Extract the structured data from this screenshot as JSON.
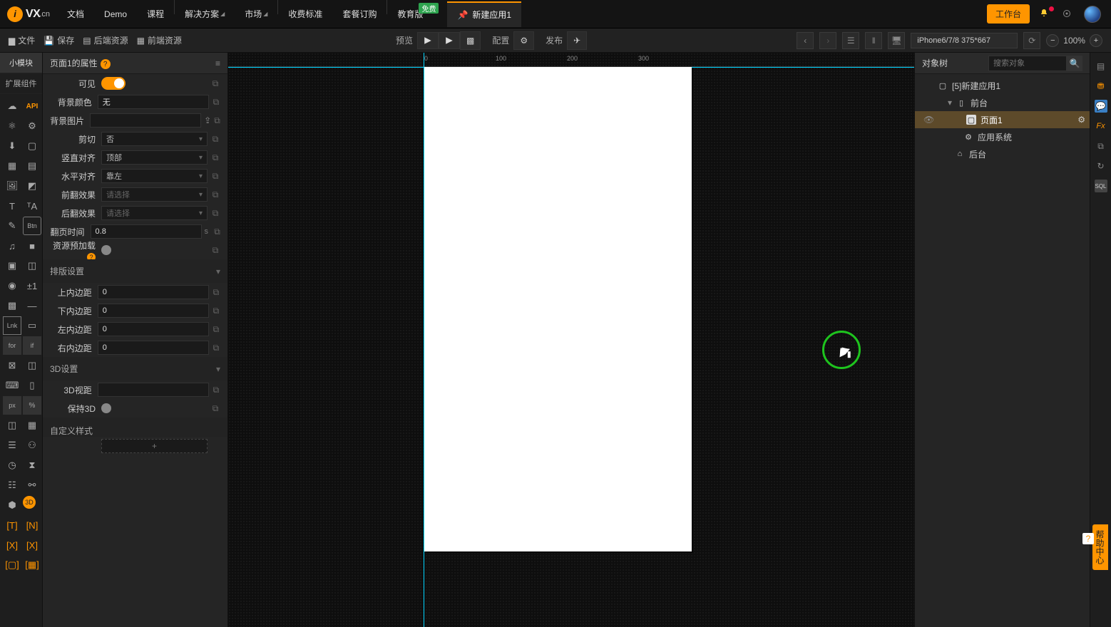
{
  "brand": {
    "short": "i",
    "name": "VX",
    "suffix": ".cn"
  },
  "nav": {
    "items": [
      "文档",
      "Demo",
      "课程",
      "解决方案",
      "市场",
      "收费标准",
      "套餐订购",
      "教育版"
    ],
    "free_badge": "免费"
  },
  "tab": {
    "label": "新建应用1"
  },
  "top_right": {
    "console": "工作台"
  },
  "subbar": {
    "file": "文件",
    "save": "保存",
    "backend": "后端资源",
    "frontend": "前端资源",
    "preview": "预览",
    "config": "配置",
    "publish": "发布",
    "device": "iPhone6/7/8 375*667",
    "zoom": "100%"
  },
  "tools": {
    "tab1": "小模块",
    "tab2": "扩展组件",
    "api": "API"
  },
  "props": {
    "title": "页面1的属性",
    "rows": {
      "visible": "可见",
      "bgcolor": "背景颜色",
      "bgcolor_val": "无",
      "bgimg": "背景图片",
      "clip": "剪切",
      "clip_val": "否",
      "valign": "竖直对齐",
      "valign_val": "顶部",
      "halign": "水平对齐",
      "halign_val": "靠左",
      "fx_in": "前翻效果",
      "fx_in_val": "请选择",
      "fx_out": "后翻效果",
      "fx_out_val": "请选择",
      "fliptime": "翻页时间",
      "fliptime_val": "0.8",
      "fliptime_unit": "s",
      "preload": "资源预加载"
    },
    "section_layout": "排版设置",
    "padding": {
      "top_l": "上内边距",
      "top_v": "0",
      "bottom_l": "下内边距",
      "bottom_v": "0",
      "left_l": "左内边距",
      "left_v": "0",
      "right_l": "右内边距",
      "right_v": "0"
    },
    "section_3d": "3D设置",
    "d3": {
      "persp_l": "3D视距",
      "persp_v": "",
      "keep_l": "保持3D"
    },
    "section_custom": "自定义样式",
    "add": "+"
  },
  "ruler": {
    "m0": "0",
    "m100": "100",
    "m200": "200",
    "m300": "300"
  },
  "tree": {
    "title": "对象树",
    "search_ph": "搜索对象",
    "root": "[5]新建应用1",
    "front": "前台",
    "page": "页面1",
    "appsys": "应用系统",
    "back": "后台"
  },
  "help": {
    "label": "帮助中心",
    "q": "?"
  }
}
